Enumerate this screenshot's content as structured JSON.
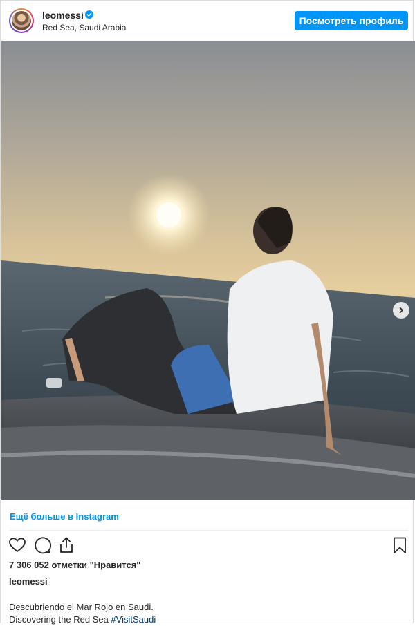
{
  "header": {
    "username": "leomessi",
    "location": "Red Sea, Saudi Arabia",
    "view_profile": "Посмотреть профиль",
    "verified": true
  },
  "carousel": {
    "total": 2,
    "current": 1
  },
  "more_link": "Ещё больше в Instagram",
  "stats": {
    "likes_text": "7 306 052 отметки \"Нравится\""
  },
  "caption": {
    "username": "leomessi",
    "line1": "Descubriendo el Mar Rojo en Saudi.",
    "line2_text": "Discovering the Red Sea ",
    "hashtag": "#VisitSaudi"
  },
  "icons": {
    "like": "heart-icon",
    "comment": "comment-icon",
    "share": "share-icon",
    "save": "bookmark-icon",
    "next": "chevron-right-icon"
  },
  "colors": {
    "accent": "#0095f6",
    "hashtag": "#00376b",
    "text": "#262626"
  }
}
